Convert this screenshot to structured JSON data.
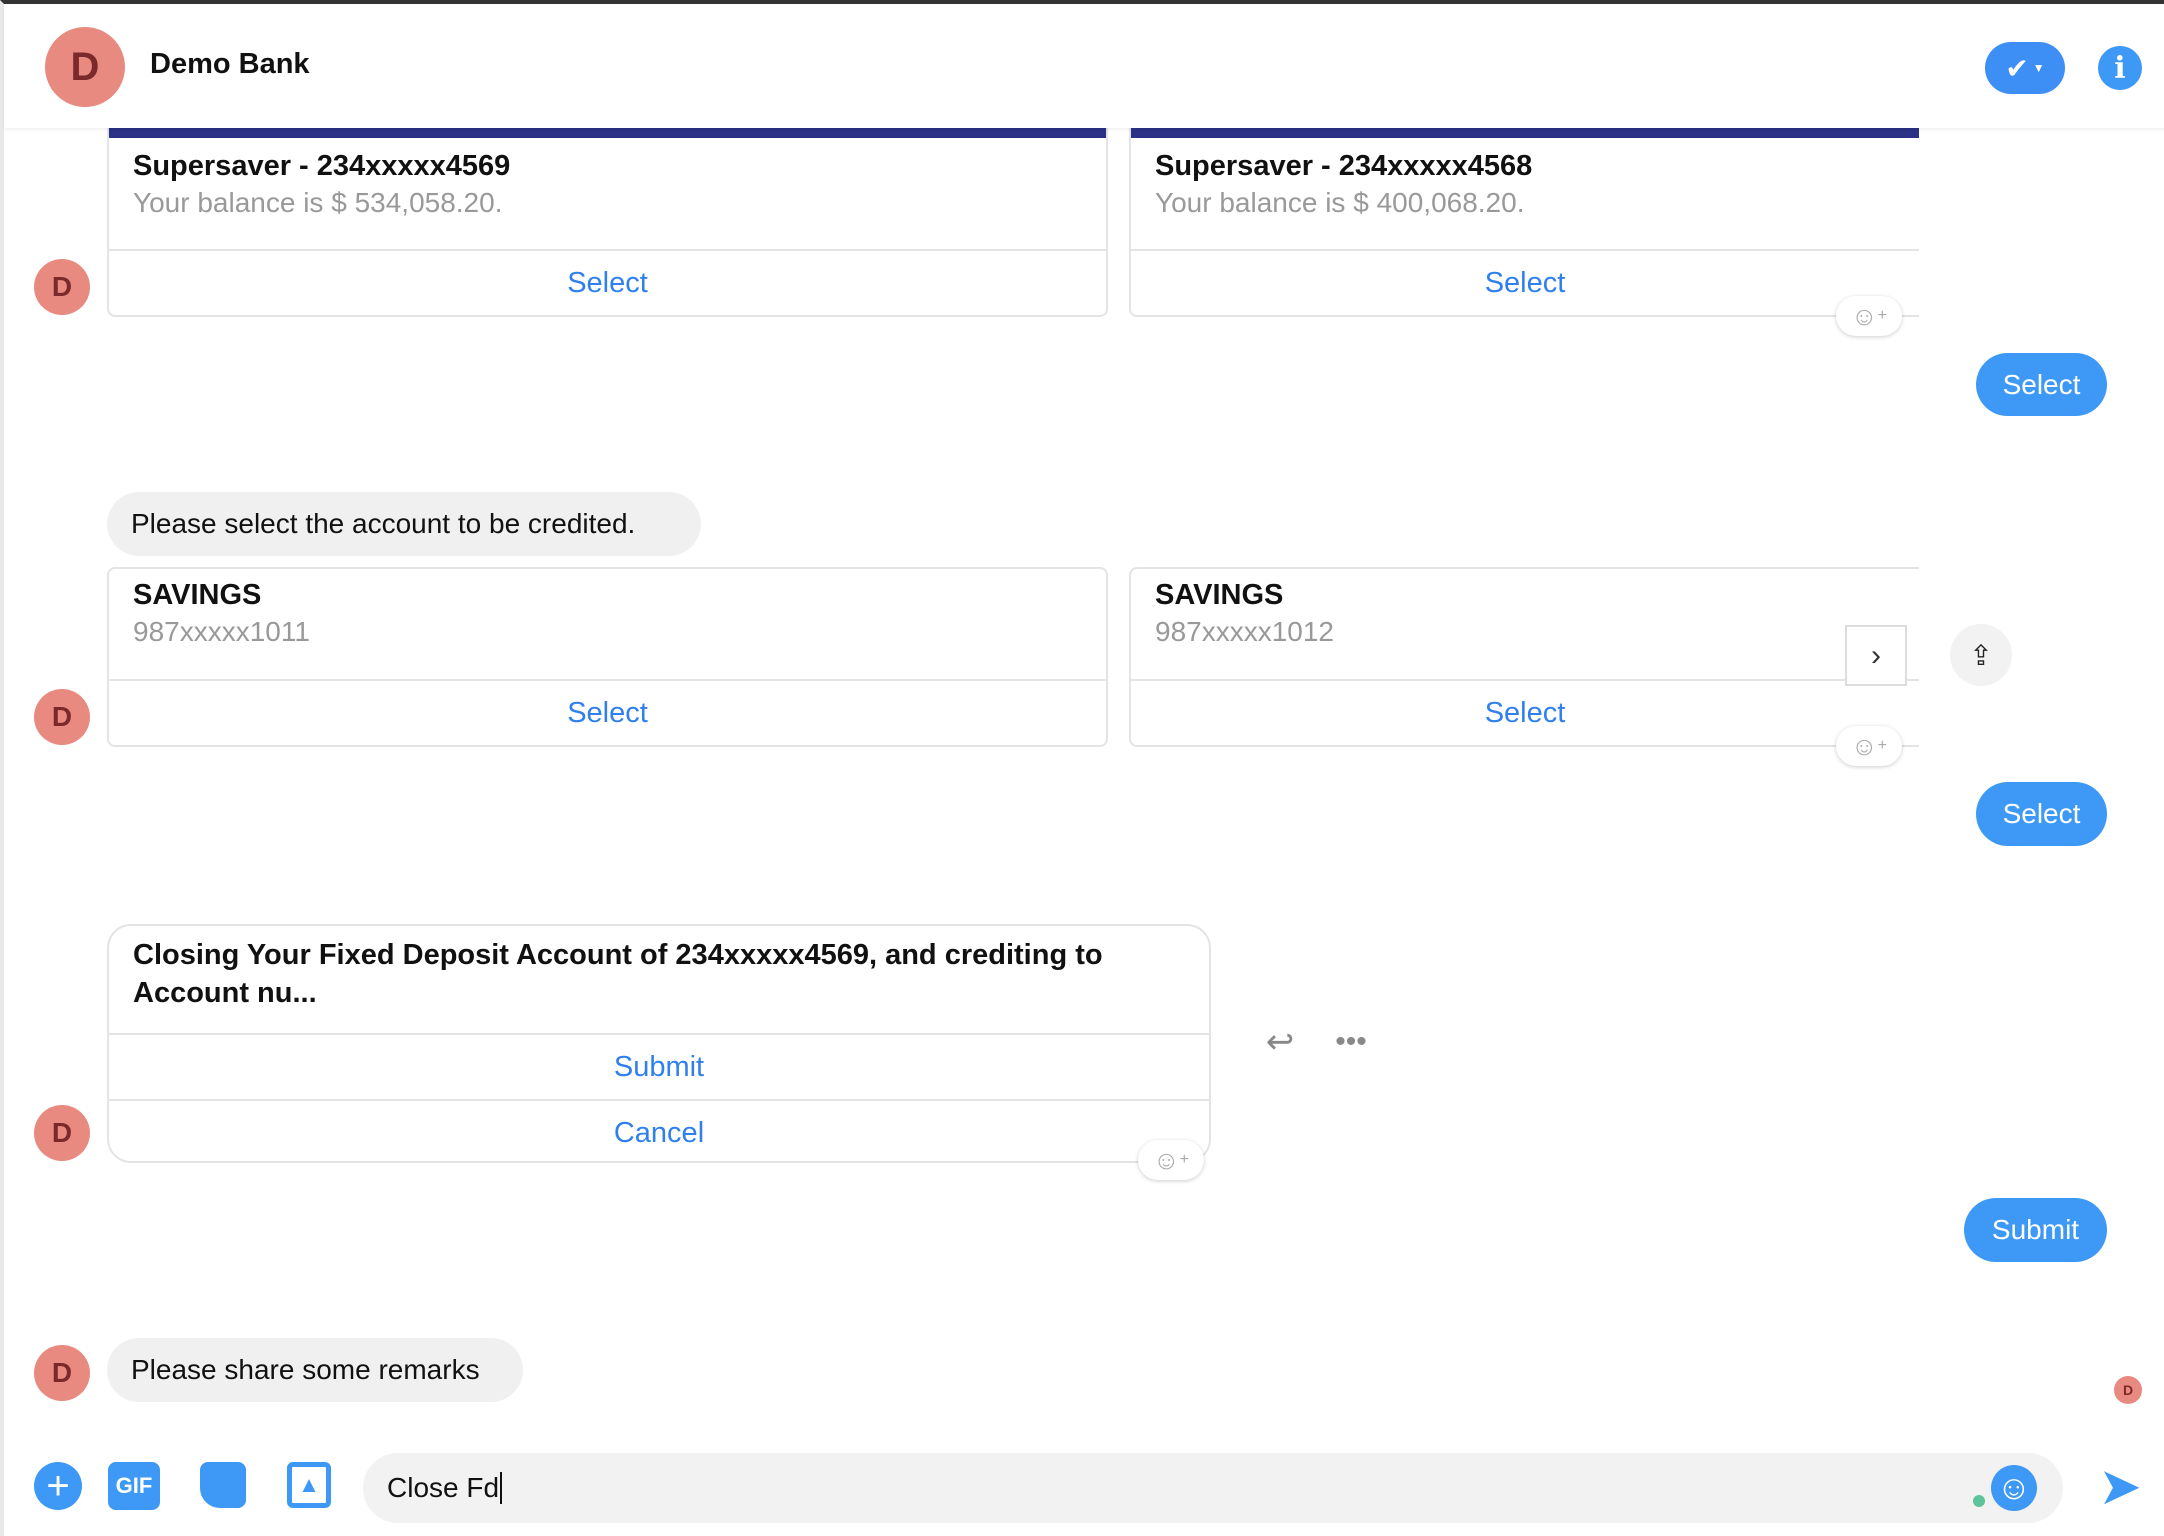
{
  "header": {
    "title": "Demo Bank",
    "avatar_letter": "D"
  },
  "messages": {
    "cards1": [
      {
        "title": "Supersaver - 234xxxxx4569",
        "subtitle": "Your balance is $ 534,058.20.",
        "button": "Select"
      },
      {
        "title": "Supersaver - 234xxxxx4568",
        "subtitle": "Your balance is $ 400,068.20.",
        "button": "Select"
      }
    ],
    "reply1": "Select",
    "prompt2": "Please select the account to be credited.",
    "cards2": [
      {
        "title": "SAVINGS",
        "subtitle": "987xxxxx1011",
        "button": "Select"
      },
      {
        "title": "SAVINGS",
        "subtitle": "987xxxxx1012",
        "button": "Select"
      }
    ],
    "reply2": "Select",
    "confirm": {
      "text": "Closing Your Fixed Deposit Account of 234xxxxx4569, and crediting to Account nu...",
      "buttons": [
        "Submit",
        "Cancel"
      ]
    },
    "reply3": "Submit",
    "prompt4": "Please share some remarks"
  },
  "composer": {
    "value": "Close Fd",
    "gif_label": "GIF"
  },
  "colors": {
    "accent": "#3d99f5",
    "avatar": "#e88a80",
    "card_band": "#2b3185"
  }
}
